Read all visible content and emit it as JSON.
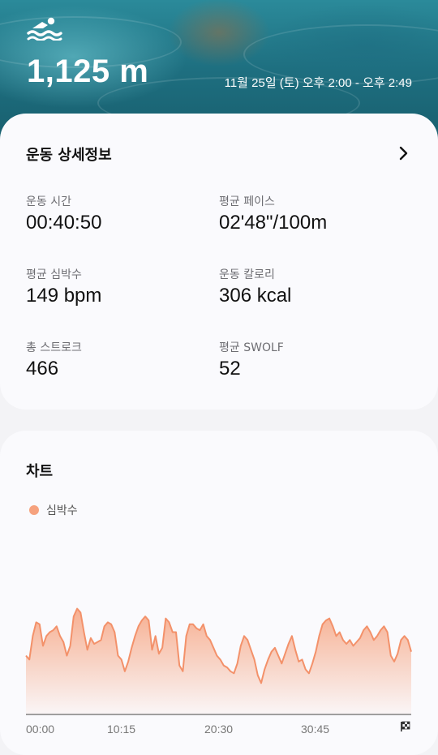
{
  "header": {
    "icon": "swimming-icon",
    "distance": "1,125 m",
    "datetime": "11월 25일 (토) 오후 2:00 - 오후 2:49"
  },
  "details": {
    "title": "운동 상세정보",
    "stats": [
      {
        "label": "운동 시간",
        "value": "00:40:50"
      },
      {
        "label": "평균 페이스",
        "value": "02'48\"/100m"
      },
      {
        "label": "평균 심박수",
        "value": "149 bpm"
      },
      {
        "label": "운동 칼로리",
        "value": "306 kcal"
      },
      {
        "label": "총 스트로크",
        "value": "466"
      },
      {
        "label": "평균 SWOLF",
        "value": "52"
      }
    ]
  },
  "chart": {
    "title": "차트",
    "legend": "심박수",
    "accent": "#f6a27e"
  },
  "chart_data": {
    "type": "area",
    "series": [
      {
        "name": "심박수",
        "values": [
          140,
          138,
          150,
          157,
          156,
          145,
          150,
          152,
          153,
          155,
          150,
          147,
          140,
          145,
          160,
          164,
          162,
          152,
          143,
          149,
          146,
          147,
          148,
          155,
          157,
          156,
          152,
          140,
          138,
          132,
          137,
          144,
          150,
          155,
          158,
          160,
          158,
          143,
          150,
          141,
          144,
          159,
          157,
          152,
          152,
          135,
          132,
          150,
          156,
          156,
          154,
          153,
          156,
          150,
          148,
          144,
          140,
          138,
          135,
          134,
          132,
          131,
          136,
          145,
          150,
          148,
          143,
          138,
          130,
          126,
          133,
          138,
          142,
          144,
          140,
          136,
          141,
          146,
          150,
          143,
          137,
          138,
          133,
          131,
          136,
          142,
          150,
          156,
          158,
          159,
          155,
          150,
          152,
          148,
          146,
          148,
          145,
          147,
          149,
          153,
          155,
          152,
          148,
          150,
          153,
          155,
          152,
          140,
          137,
          141,
          148,
          150,
          148,
          142
        ]
      }
    ],
    "x_tick_labels": [
      "00:00",
      "10:15",
      "20:30",
      "30:45"
    ],
    "grid": false
  }
}
